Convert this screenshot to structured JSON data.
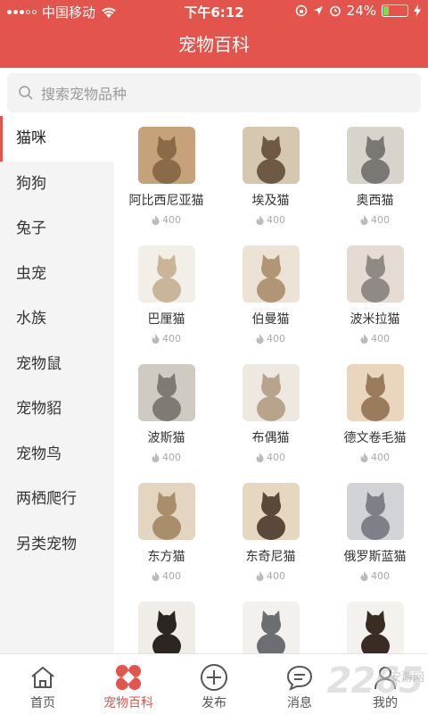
{
  "status": {
    "carrier": "中国移动",
    "time": "下午6:12",
    "battery": "24%",
    "battery_level": 0.24
  },
  "header": {
    "title": "宠物百科"
  },
  "search": {
    "placeholder": "搜索宠物品种"
  },
  "sidebar": {
    "items": [
      {
        "label": "猫咪",
        "active": true
      },
      {
        "label": "狗狗"
      },
      {
        "label": "兔子"
      },
      {
        "label": "虫宠"
      },
      {
        "label": "水族"
      },
      {
        "label": "宠物鼠"
      },
      {
        "label": "宠物貂"
      },
      {
        "label": "宠物鸟"
      },
      {
        "label": "两栖爬行"
      },
      {
        "label": "另类宠物"
      }
    ]
  },
  "breeds": [
    {
      "name": "阿比西尼亚猫",
      "hot": "400"
    },
    {
      "name": "埃及猫",
      "hot": "400"
    },
    {
      "name": "奥西猫",
      "hot": "400"
    },
    {
      "name": "巴厘猫",
      "hot": "400"
    },
    {
      "name": "伯曼猫",
      "hot": "400"
    },
    {
      "name": "波米拉猫",
      "hot": "400"
    },
    {
      "name": "波斯猫",
      "hot": "400"
    },
    {
      "name": "布偶猫",
      "hot": "400"
    },
    {
      "name": "德文卷毛猫",
      "hot": "400"
    },
    {
      "name": "东方猫",
      "hot": "400"
    },
    {
      "name": "东奇尼猫",
      "hot": "400"
    },
    {
      "name": "俄罗斯蓝猫",
      "hot": "400"
    },
    {
      "name": "",
      "hot": ""
    },
    {
      "name": "",
      "hot": ""
    },
    {
      "name": "",
      "hot": ""
    }
  ],
  "tabs": [
    {
      "label": "首页",
      "icon": "home-icon"
    },
    {
      "label": "宠物百科",
      "icon": "pet-encyclopedia-icon",
      "active": true
    },
    {
      "label": "发布",
      "icon": "plus-circle-icon"
    },
    {
      "label": "消息",
      "icon": "chat-icon"
    },
    {
      "label": "我的",
      "icon": "user-icon"
    }
  ],
  "watermark": {
    "logo": "2265",
    "small": "安游网"
  },
  "colors": {
    "brand": "#e2544c",
    "sidebar_bg": "#f4f4f4"
  }
}
